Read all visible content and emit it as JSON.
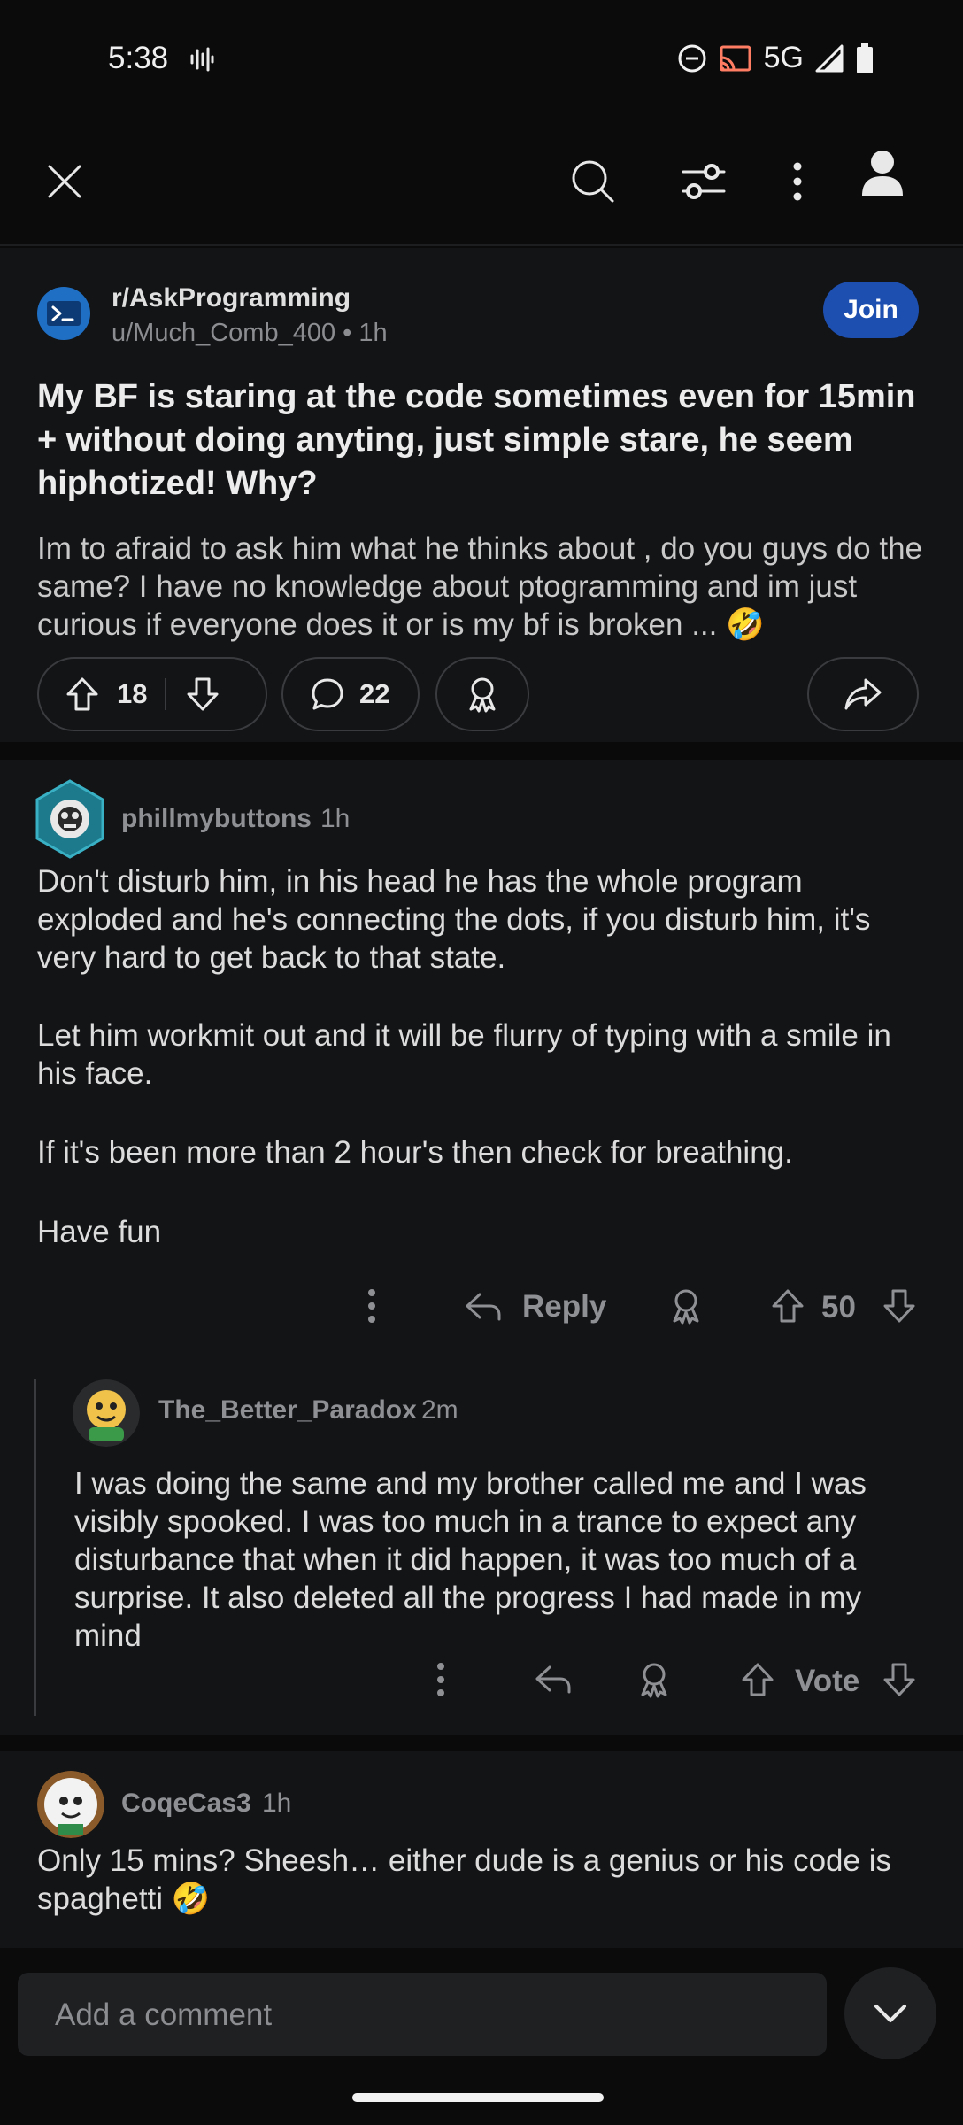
{
  "status_bar": {
    "time": "5:38",
    "network": "5G",
    "icons": [
      "wave-icon",
      "dnd-icon",
      "cast-icon",
      "signal-icon",
      "battery-icon"
    ]
  },
  "toolbar": {
    "icons": [
      "close-icon",
      "search-icon",
      "filter-icon",
      "more-icon",
      "profile-icon"
    ]
  },
  "post": {
    "subreddit": "r/AskProgramming",
    "author": "u/Much_Comb_400",
    "time": "1h",
    "join_label": "Join",
    "title": "My BF is staring at the code sometimes even for 15min + without doing anyting, just simple stare, he seem hiphotized! Why?",
    "body": "Im to afraid to ask him what he thinks about , do you guys do the same? I have no knowledge about ptogramming and im just curious if everyone does it or is my bf is broken ... 🤣",
    "upvotes": "18",
    "comments": "22"
  },
  "comments": [
    {
      "username": "phillmybuttons",
      "time": "1h",
      "paragraphs": [
        "Don't disturb him, in his head he has the whole program exploded and he's connecting the dots, if you disturb him, it's very hard to get back to that state.",
        "Let him workmit out and it will be flurry of typing with a smile in his face.",
        "If it's been more than 2 hour's then check for breathing.",
        "Have fun"
      ],
      "reply_label": "Reply",
      "score": "50"
    },
    {
      "username": "The_Better_Paradox",
      "time": "2m",
      "text": "I was doing the same and my brother called me and I was visibly spooked. I was too much in a trance to expect any disturbance that when it did happen, it was too much of a surprise. It also deleted all the progress I had made in my mind",
      "score": "Vote"
    },
    {
      "username": "CoqeCas3",
      "time": "1h",
      "text": "Only 15 mins? Sheesh… either dude is a genius or his code is spaghetti 🤣"
    }
  ],
  "composer": {
    "placeholder": "Add a comment"
  },
  "colors": {
    "background": "#0b0b0c",
    "card": "#131416",
    "join": "#1d4fb0",
    "muted": "#8e9094"
  }
}
